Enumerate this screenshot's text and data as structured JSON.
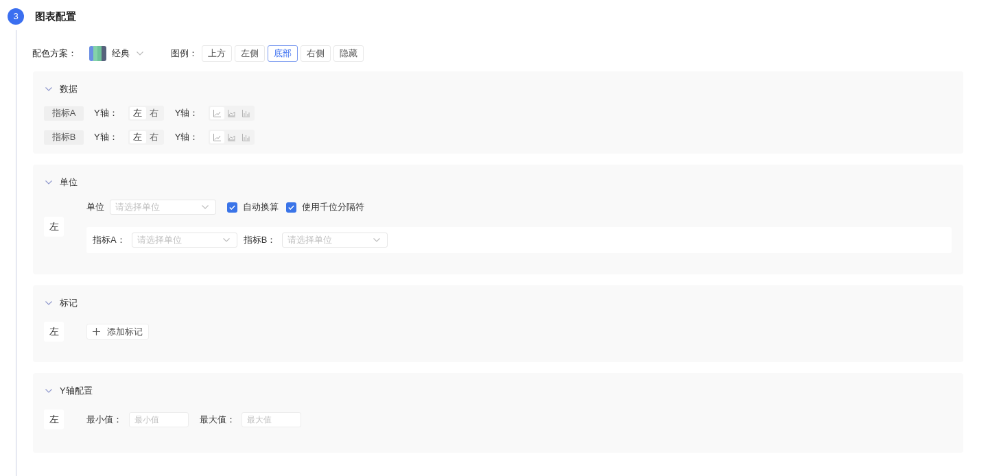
{
  "step": {
    "number": "3",
    "title": "图表配置"
  },
  "color_scheme": {
    "label": "配色方案：",
    "value": "经典"
  },
  "legend": {
    "label": "图例：",
    "options": [
      {
        "label": "上方",
        "selected": false
      },
      {
        "label": "左侧",
        "selected": false
      },
      {
        "label": "底部",
        "selected": true
      },
      {
        "label": "右侧",
        "selected": false
      },
      {
        "label": "隐藏",
        "selected": false
      }
    ]
  },
  "sections": [
    {
      "kind": "data",
      "title": "数据",
      "expanded": true,
      "rows": [
        {
          "metric": "指标A",
          "axis_label": "Y轴：",
          "axis_options": [
            {
              "label": "左",
              "selected": true
            },
            {
              "label": "右",
              "selected": false
            }
          ],
          "chart_label": "Y轴：",
          "chart_types": [
            {
              "kind": "line",
              "selected": true
            },
            {
              "kind": "area",
              "selected": false
            },
            {
              "kind": "bar",
              "selected": false
            }
          ]
        },
        {
          "metric": "指标B",
          "axis_label": "Y轴：",
          "axis_options": [
            {
              "label": "左",
              "selected": true
            },
            {
              "label": "右",
              "selected": false
            }
          ],
          "chart_label": "Y轴：",
          "chart_types": [
            {
              "kind": "line",
              "selected": true
            },
            {
              "kind": "area",
              "selected": false
            },
            {
              "kind": "bar",
              "selected": false
            }
          ]
        }
      ]
    },
    {
      "kind": "unit",
      "title": "单位",
      "expanded": true,
      "side": "左",
      "unit_label": "单位",
      "unit_select": {
        "placeholder": "请选择单位"
      },
      "checkboxes": [
        {
          "label": "自动换算",
          "checked": true
        },
        {
          "label": "使用千位分隔符",
          "checked": true
        }
      ],
      "metric_units": [
        {
          "label": "指标A：",
          "placeholder": "请选择单位"
        },
        {
          "label": "指标B：",
          "placeholder": "请选择单位"
        }
      ]
    },
    {
      "kind": "marks",
      "title": "标记",
      "expanded": true,
      "side": "左",
      "add_button": "添加标记"
    },
    {
      "kind": "y_axis",
      "title": "Y轴配置",
      "expanded": true,
      "side": "左",
      "fields": [
        {
          "label": "最小值：",
          "placeholder": "最小值"
        },
        {
          "label": "最大值：",
          "placeholder": "最大值"
        }
      ]
    }
  ]
}
